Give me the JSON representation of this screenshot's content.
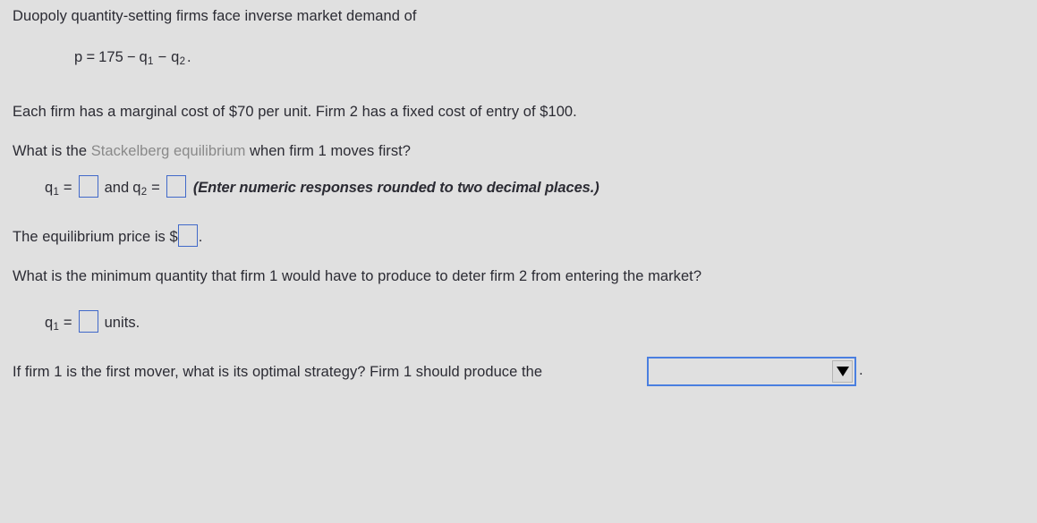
{
  "problem": {
    "intro": "Duopoly quantity-setting firms face inverse market demand of",
    "equation": {
      "lhs": "p",
      "eq": "=",
      "constant": "175",
      "minus1": "−",
      "q1": "q",
      "q1_sub": "1",
      "minus2": "−",
      "q2": "q",
      "q2_sub": "2",
      "period": "."
    },
    "costs": "Each firm has a marginal cost of $70 per unit.  Firm 2 has a fixed cost of entry of $100."
  },
  "question_stackelberg": {
    "prefix": "What is the ",
    "term": "Stackelberg equilibrium",
    "suffix": " when firm 1 moves first?"
  },
  "answer_row": {
    "q1_label": "q",
    "q1_sub": "1",
    "equals1": "=",
    "q1_value": "",
    "conjunction": "and",
    "q2_label": "q",
    "q2_sub": "2",
    "equals2": "=",
    "q2_value": "",
    "hint": "(Enter numeric responses rounded to two decimal places.)"
  },
  "price_row": {
    "prefix": "The equilibrium price is $",
    "value": "",
    "suffix": "."
  },
  "question_deter": "What is the minimum quantity that firm 1 would have to produce to deter firm 2 from entering the market?",
  "units_row": {
    "q_label": "q",
    "q_sub": "1",
    "equals": "=",
    "value": "",
    "suffix": "units."
  },
  "strategy_row": {
    "question": "If firm 1 is the first mover, what is its optimal strategy?  Firm 1 should produce the",
    "dropdown_value": "",
    "dropdown_icon": "chevron-down-icon",
    "period": "."
  },
  "colors": {
    "background": "#e0e0e0",
    "text": "#2b2b33",
    "muted_term": "#898989",
    "input_border": "#4169c9",
    "dropdown_border": "#4a7fe0",
    "arrow": "#000000"
  }
}
